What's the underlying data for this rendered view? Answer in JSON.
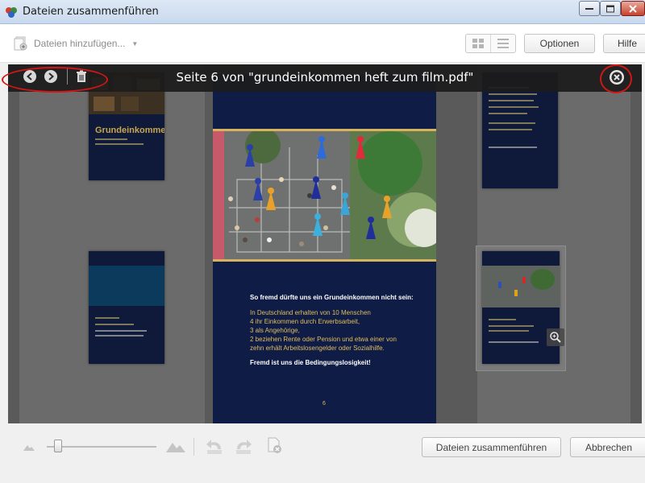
{
  "window": {
    "title": "Dateien zusammenführen"
  },
  "toolbar": {
    "add_files_label": "Dateien hinzufügen...",
    "options_label": "Optionen",
    "help_label": "Hilfe"
  },
  "preview": {
    "title": "Seite 6 von \"grundeinkommen heft zum film.pdf\"",
    "page": {
      "heading": "So fremd dürfte uns ein Grundeinkommen nicht sein:",
      "body_lines": [
        "In Deutschland erhalten von 10 Menschen",
        "4 ihr Einkommen durch Erwerbsarbeit,",
        "3 als Angehörige,",
        "2 beziehen Rente oder Pension und etwa einer von",
        "zehn erhält Arbeitslosengelder oder Sozialhilfe."
      ],
      "closing": "Fremd ist uns die Bedingungslosigkeit!",
      "number": "6"
    }
  },
  "thumbnails": {
    "first_title": "Grundeinkommen"
  },
  "footer": {
    "merge_label": "Dateien zusammenführen",
    "cancel_label": "Abbrechen"
  },
  "colors": {
    "page_navy": "#0e1c46",
    "page_gold": "#e2be5e",
    "annotation_red": "#d21616"
  },
  "icons": {
    "prev": "arrow-left-circle-icon",
    "next": "arrow-right-circle-icon",
    "trash": "trash-icon",
    "close": "close-circle-icon",
    "zoom": "magnifier-icon"
  }
}
